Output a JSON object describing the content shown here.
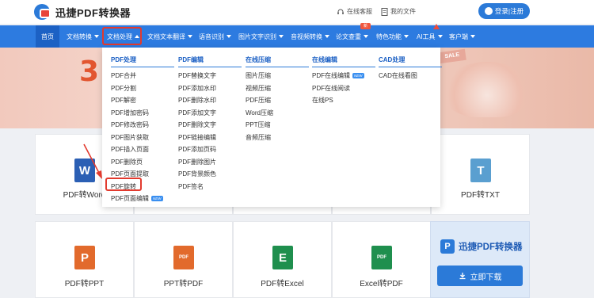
{
  "brand": {
    "name": "迅捷PDF转换器"
  },
  "header": {
    "service_label": "在线客服",
    "files_label": "我的文件",
    "login_label": "登录|注册"
  },
  "nav": {
    "items": [
      {
        "label": "首页"
      },
      {
        "label": "文档转换"
      },
      {
        "label": "文档处理"
      },
      {
        "label": "文档文本翻译"
      },
      {
        "label": "语音识别"
      },
      {
        "label": "图片文字识别"
      },
      {
        "label": "音视频转换"
      },
      {
        "label": "论文查重"
      },
      {
        "label": "特色功能"
      },
      {
        "label": "AI工具"
      },
      {
        "label": "客户端"
      }
    ],
    "new_badge": "新"
  },
  "banner": {
    "number": "3",
    "sale": "SALE"
  },
  "dropdown": {
    "columns": [
      {
        "title": "PDF处理",
        "items": [
          "PDF合并",
          "PDF分割",
          "PDF解密",
          "PDF增加密码",
          "PDF修改密码",
          "PDF图片获取",
          "PDF插入页面",
          "PDF删除页",
          "PDF页面提取",
          "PDF旋转",
          "PDF页面编辑"
        ]
      },
      {
        "title": "PDF编辑",
        "items": [
          "PDF替换文字",
          "PDF添加水印",
          "PDF删除水印",
          "PDF添加文字",
          "PDF删除文字",
          "PDF链接编辑",
          "PDF添加页码",
          "PDF删除图片",
          "PDF背景颜色",
          "PDF签名"
        ]
      },
      {
        "title": "在线压缩",
        "items": [
          "图片压缩",
          "视频压缩",
          "PDF压缩",
          "Word压缩",
          "PPT压缩",
          "音频压缩"
        ]
      },
      {
        "title": "在线编辑",
        "items": [
          "PDF在线编辑",
          "PDF在线阅读",
          "在线PS"
        ]
      },
      {
        "title": "CAD处理",
        "items": [
          "CAD在线看图"
        ]
      }
    ],
    "new_tag": "NEW"
  },
  "cards": {
    "row1": [
      {
        "label": "PDF转Word",
        "icon": "W"
      },
      {
        "label": "PDF转TXT",
        "icon": "T"
      }
    ],
    "row2": [
      {
        "label": "PDF转PPT",
        "icon": "P"
      },
      {
        "label": "PPT转PDF",
        "icon": "PDF"
      },
      {
        "label": "PDF转Excel",
        "icon": "E"
      },
      {
        "label": "Excel转PDF",
        "icon": "PDF"
      }
    ]
  },
  "promo": {
    "logo_letter": "P",
    "title": "迅捷PDF转换器",
    "download_label": "立即下载"
  },
  "colors": {
    "primary": "#2d7be0",
    "highlight": "#e23a2e",
    "word": "#2b5fb4",
    "ppt": "#e26a2c",
    "excel": "#1f8f4e",
    "txt": "#5a9fd0"
  }
}
